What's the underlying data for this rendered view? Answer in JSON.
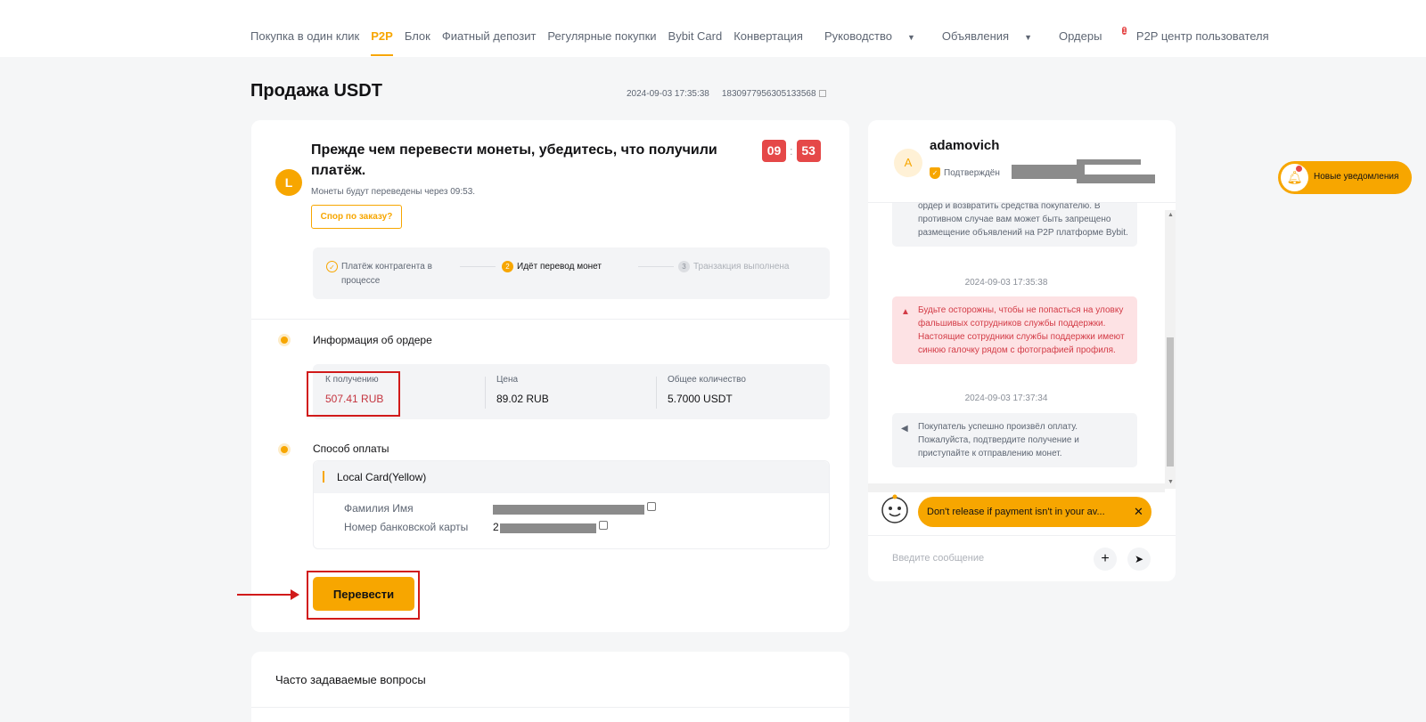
{
  "nav": {
    "left": [
      {
        "label": "Покупка в один клик",
        "active": false
      },
      {
        "label": "P2P",
        "active": true
      },
      {
        "label": "Блок",
        "active": false
      },
      {
        "label": "Фиатный депозит",
        "active": false
      },
      {
        "label": "Регулярные покупки",
        "active": false
      },
      {
        "label": "Bybit Card",
        "active": false
      },
      {
        "label": "Конвертация",
        "active": false
      }
    ],
    "right": {
      "guide": "Руководство",
      "ads": "Объявления",
      "orders": "Ордеры",
      "orders_badge": "1",
      "p2p_center": "P2P центр пользователя"
    }
  },
  "header": {
    "title": "Продажа USDT",
    "datetime": "2024-09-03 17:35:38",
    "order_id": "1830977956305133568"
  },
  "status": {
    "icon_letter": "L",
    "headline": "Прежде чем перевести монеты, убедитесь, что получили платёж.",
    "subline": "Монеты будут переведены через 09:53.",
    "timer_min": "09",
    "timer_sec": "53",
    "dispute_label": "Спор по заказу?"
  },
  "steps": [
    {
      "num": "✓",
      "label": "Платёж контрагента в процессе"
    },
    {
      "num": "2",
      "label": "Идёт перевод монет"
    },
    {
      "num": "3",
      "label": "Транзакция выполнена"
    }
  ],
  "order_info": {
    "title": "Информация об ордере",
    "receive_label": "К получению",
    "receive_value": "507.41 RUB",
    "price_label": "Цена",
    "price_value": "89.02 RUB",
    "total_label": "Общее количество",
    "total_value": "5.7000 USDT"
  },
  "payment": {
    "title": "Способ оплаты",
    "method": "Local Card(Yellow)",
    "name_label": "Фамилия Имя",
    "card_label": "Номер банковской карты",
    "card_prefix": "2"
  },
  "transfer_label": "Перевести",
  "faq_title": "Часто задаваемые вопросы",
  "chat": {
    "avatar_letter": "A",
    "name": "adamovich",
    "verified": "Подтверждён",
    "msg1": "ордер и возвратить средства покупателю. В противном случае вам может быть запрещено размещение объявлений на P2P платформе Bybit.",
    "time1": "2024-09-03 17:35:38",
    "msg2": "Будьте осторожны, чтобы не попасться на уловку фальшивых сотрудников службы поддержки. Настоящие сотрудники службы поддержки имеют синюю галочку рядом с фотографией профиля.",
    "time2": "2024-09-03 17:37:34",
    "msg3": "Покупатель успешно произвёл оплату. Пожалуйста, подтвердите получение и приступайте к отправлению монет.",
    "tip": "Don't release if payment isn't in your av...",
    "input_placeholder": "Введите сообщение"
  },
  "notification": "Новые уведомления",
  "colors": {
    "accent": "#f7a600",
    "danger": "#e54848",
    "annotation": "#d11a1a"
  }
}
